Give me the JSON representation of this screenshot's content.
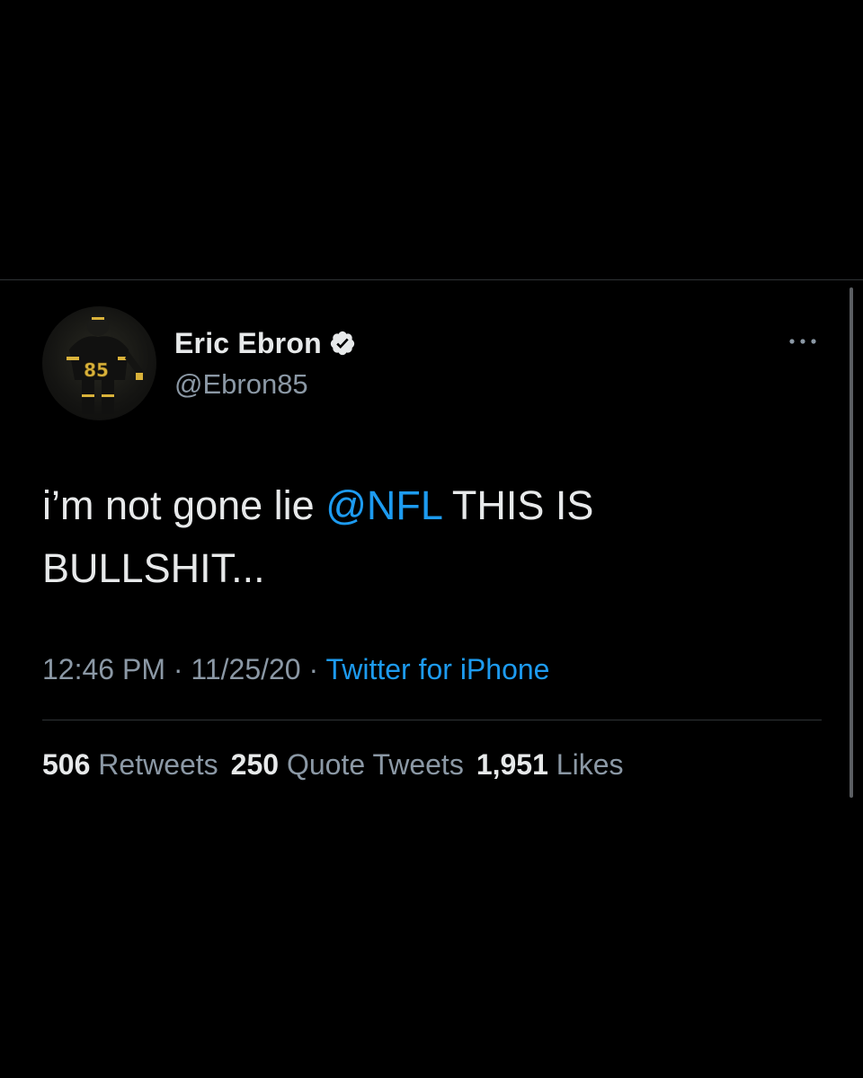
{
  "author": {
    "display_name": "Eric Ebron",
    "handle": "@Ebron85",
    "verified_icon": "verified-badge-icon",
    "avatar_jersey_number": "85"
  },
  "tweet": {
    "text_before": "i’m not gone lie ",
    "mention": "@NFL",
    "text_after": " THIS IS BULLSHIT..."
  },
  "meta": {
    "time": "12:46 PM",
    "separator": " · ",
    "date": "11/25/20",
    "source": "Twitter for iPhone"
  },
  "stats": {
    "retweets": {
      "count": "506",
      "label": " Retweets"
    },
    "quote_tweets": {
      "count": "250",
      "label": " Quote Tweets"
    },
    "likes": {
      "count": "1,951",
      "label": " Likes"
    }
  },
  "colors": {
    "background": "#000000",
    "text": "#e7e9ea",
    "secondary": "#8b98a5",
    "link": "#1d9bf0"
  }
}
